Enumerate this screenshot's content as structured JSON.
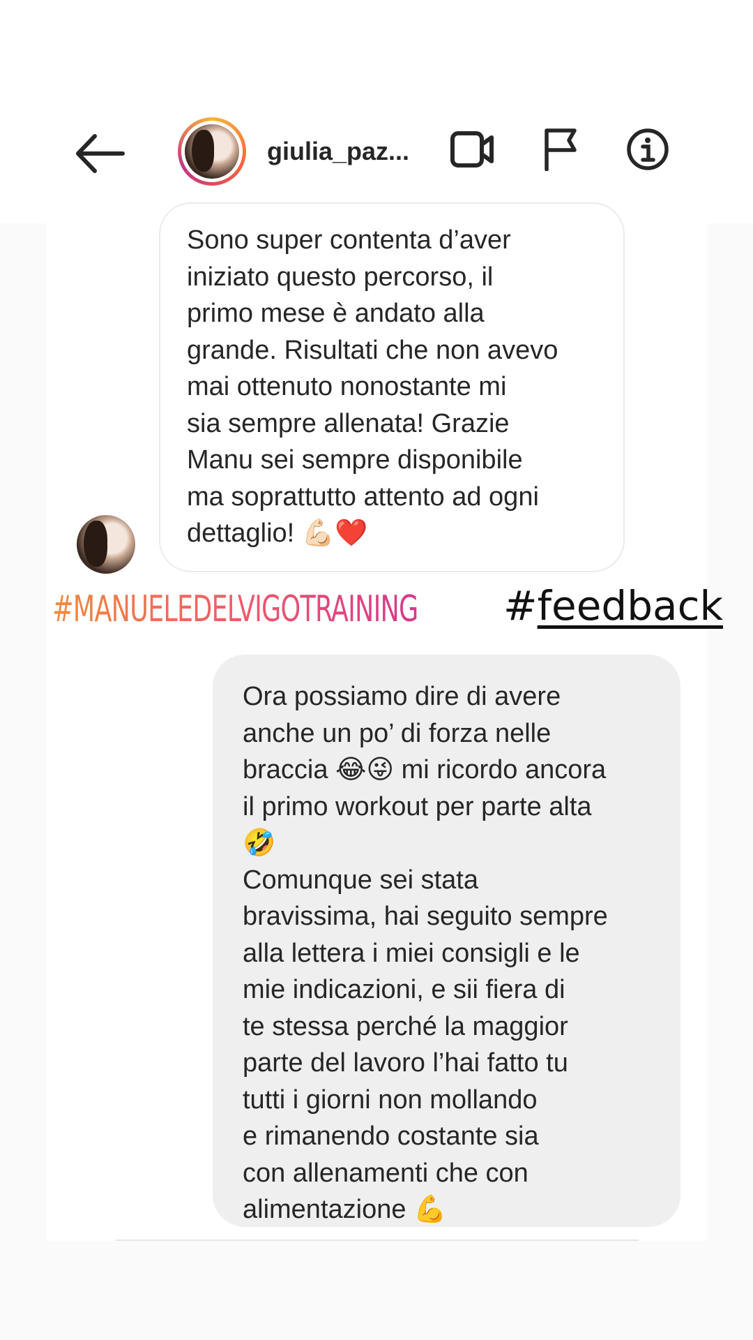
{
  "header": {
    "username": "giulia_paz...",
    "icons": [
      "back-arrow-icon",
      "video-call-icon",
      "flag-icon",
      "info-icon"
    ]
  },
  "messages": {
    "incoming": "Sono super contenta d’aver\niniziato questo percorso, il\nprimo mese è andato alla\ngrande. Risultati che non avevo\nmai ottenuto nonostante mi\nsia sempre allenata! Grazie\nManu sei sempre disponibile\nma soprattutto attento ad ogni\ndettaglio! 💪🏻❤️",
    "outgoing": "Ora possiamo dire di avere\nanche un po’ di forza nelle\nbraccia 😂😜 mi ricordo ancora\nil primo workout per parte alta\n🤣\nComunque sei stata\nbravissima, hai seguito sempre\nalla lettera i miei consigli e le\nmie indicazioni, e sii fiera di\nte stessa perché la maggior\nparte del lavoro l’hai fatto tu\ntutti i giorni non mollando\ne rimanendo costante sia\ncon allenamenti che con\nalimentazione 💪"
  },
  "overlay": {
    "brand_hashtag": "#MANUELEDELVIGOTRAINING",
    "feedback_hash": "#",
    "feedback_word": "feedback"
  },
  "colors": {
    "hashtag_gradient": [
      "#f08a3c",
      "#ee5c6a",
      "#d6368a"
    ],
    "outgoing_bubble": "#efefef",
    "text": "#262626"
  }
}
